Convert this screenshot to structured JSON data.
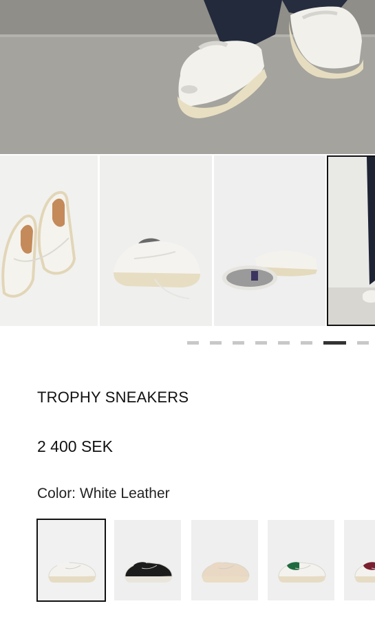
{
  "product": {
    "name": "TROPHY SNEAKERS",
    "price": "2 400 SEK",
    "color_label": "Color:",
    "color_value": "White Leather"
  },
  "gallery": {
    "thumbnails": [
      {
        "name": "pair-top-view"
      },
      {
        "name": "pair-side-view"
      },
      {
        "name": "sole-view"
      },
      {
        "name": "on-model-view",
        "selected": true
      }
    ],
    "pager": {
      "total": 9,
      "active_index": 6
    }
  },
  "color_options": [
    {
      "name": "White Leather",
      "upper": "#f3f2ee",
      "sole": "#e6dcc4",
      "accent": "#f3f2ee",
      "selected": true
    },
    {
      "name": "Black",
      "upper": "#1c1c1c",
      "sole": "#e9e5dc",
      "accent": "#1c1c1c",
      "selected": false
    },
    {
      "name": "Beige",
      "upper": "#e8d8c4",
      "sole": "#eadcc5",
      "accent": "#e8d8c4",
      "selected": false
    },
    {
      "name": "Green",
      "upper": "#f3f2ee",
      "sole": "#e6dcc4",
      "accent": "#1f6b3f",
      "selected": false
    },
    {
      "name": "Burgundy",
      "upper": "#f3f2ee",
      "sole": "#e6dcc4",
      "accent": "#7a2030",
      "selected": false
    }
  ]
}
